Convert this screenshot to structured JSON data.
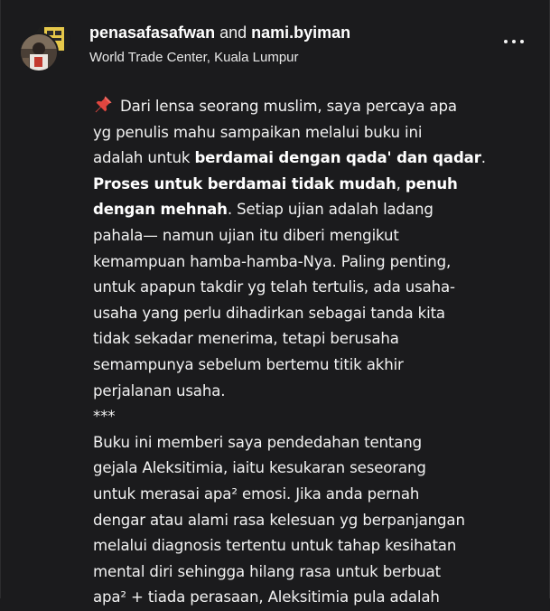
{
  "post": {
    "author_1": "penasafasafwan",
    "conjunction": "and",
    "author_2": "nami.byiman",
    "location": "World Trade Center, Kuala Lumpur"
  },
  "icons": {
    "pin": "pushpin-icon",
    "more": "more-options-icon"
  },
  "colors": {
    "background": "#1b1b1d",
    "text": "#f2f2f2",
    "pin_red": "#e0463f"
  },
  "caption": {
    "l1": "Dari lensa seorang muslim, saya percaya apa",
    "l2": "yg penulis mahu sampaikan melalui buku ini",
    "l3a": "adalah untuk ",
    "l3b": "berdamai dengan qada' dan qadar",
    "l3c": ".",
    "l4a": "Proses untuk berdamai tidak mudah",
    "l4b": ", ",
    "l4c": "penuh",
    "l5a": "dengan mehnah",
    "l5b": ". Setiap ujian adalah ladang",
    "l6": "pahala— namun ujian itu diberi mengikut",
    "l7": "kemampuan hamba-hamba-Nya. Paling penting,",
    "l8": "untuk apapun takdir yg telah tertulis, ada usaha-",
    "l9": "usaha yang perlu dihadirkan sebagai tanda kita",
    "l10": "tidak sekadar menerima, tetapi berusaha",
    "l11": "semampunya sebelum bertemu titik akhir",
    "l12": "perjalanan usaha.",
    "l13": "***",
    "l14": "Buku ini memberi saya pendedahan tentang",
    "l15": "gejala Aleksitimia, iaitu kesukaran seseorang",
    "l16": "untuk merasai apa² emosi. Jika anda pernah",
    "l17": "dengar atau alami rasa kelesuan yg berpanjangan",
    "l18": "melalui diagnosis tertentu untuk tahap kesihatan",
    "l19": "mental diri sehingga hilang rasa untuk berbuat",
    "l20": "apa² + tiada perasaan, Aleksitimia pula adalah"
  }
}
